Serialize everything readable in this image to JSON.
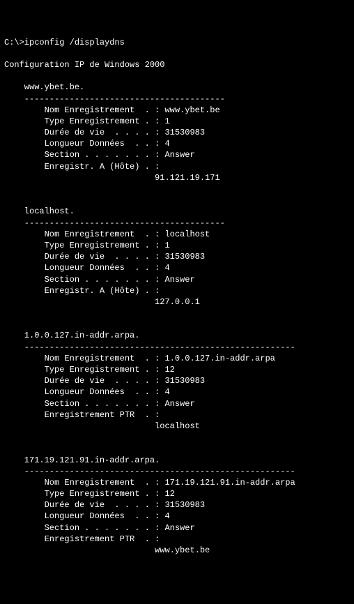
{
  "prompt": "C:\\>ipconfig /displaydns",
  "header": "Configuration IP de Windows 2000",
  "dash_short": "    ----------------------------------------",
  "dash_long": "    ------------------------------------------------------",
  "sections": [
    {
      "title": "    www.ybet.be.",
      "fields": {
        "nom": "        Nom Enregistrement  . : www.ybet.be",
        "type": "        Type Enregistrement . : 1",
        "duree": "        Durée de vie  . . . . : 31530983",
        "longueur": "        Longueur Données  . . : 4",
        "section": "        Section . . . . . . . : Answer",
        "enreg": "        Enregistr. A (Hôte) . :",
        "value": "                              91.121.19.171"
      }
    },
    {
      "title": "    localhost.",
      "fields": {
        "nom": "        Nom Enregistrement  . : localhost",
        "type": "        Type Enregistrement . : 1",
        "duree": "        Durée de vie  . . . . : 31530983",
        "longueur": "        Longueur Données  . . : 4",
        "section": "        Section . . . . . . . : Answer",
        "enreg": "        Enregistr. A (Hôte) . :",
        "value": "                              127.0.0.1"
      }
    },
    {
      "title": "    1.0.0.127.in-addr.arpa.",
      "fields": {
        "nom": "        Nom Enregistrement  . : 1.0.0.127.in-addr.arpa",
        "type": "        Type Enregistrement . : 12",
        "duree": "        Durée de vie  . . . . : 31530983",
        "longueur": "        Longueur Données  . . : 4",
        "section": "        Section . . . . . . . : Answer",
        "enreg": "        Enregistrement PTR  . :",
        "value": "                              localhost"
      }
    },
    {
      "title": "    171.19.121.91.in-addr.arpa.",
      "fields": {
        "nom": "        Nom Enregistrement  . : 171.19.121.91.in-addr.arpa",
        "type": "        Type Enregistrement . : 12",
        "duree": "        Durée de vie  . . . . : 31530983",
        "longueur": "        Longueur Données  . . : 4",
        "section": "        Section . . . . . . . : Answer",
        "enreg": "        Enregistrement PTR  . :",
        "value": "                              www.ybet.be"
      }
    }
  ]
}
